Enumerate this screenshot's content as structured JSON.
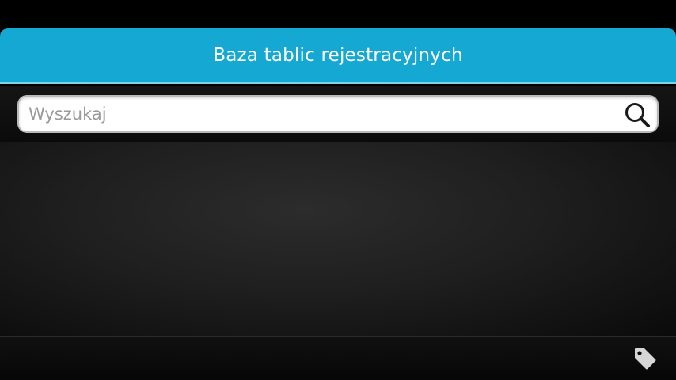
{
  "header": {
    "title": "Baza tablic rejestracyjnych"
  },
  "search": {
    "placeholder": "Wyszukaj",
    "value": "",
    "icon": "search-icon"
  },
  "toolbar": {
    "tag_icon": "tag-icon"
  },
  "colors": {
    "header_bg": "#14a8d2",
    "header_text": "#ffffff",
    "background": "#000000",
    "search_bg": "#ffffff",
    "placeholder": "#9a9a9a"
  }
}
